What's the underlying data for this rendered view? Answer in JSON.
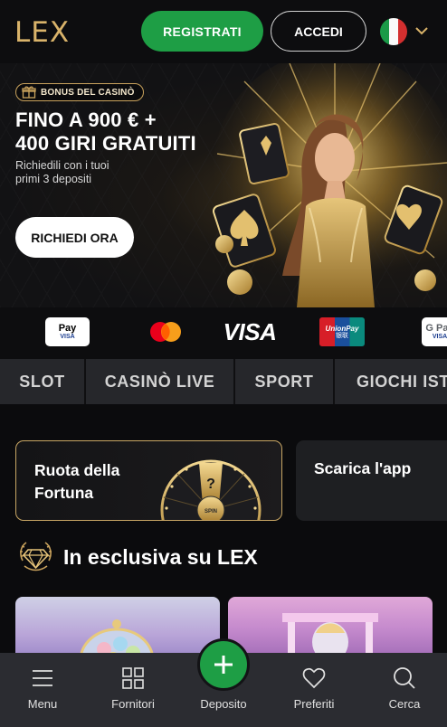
{
  "header": {
    "logo": "LEX",
    "register_label": "REGISTRATI",
    "login_label": "ACCEDI",
    "language_flag": "flag-italy-icon"
  },
  "hero": {
    "badge": "BONUS DEL CASINÒ",
    "title_line1": "FINO A 900 € +",
    "title_line2": "400 GIRI GRATUITI",
    "subtitle": "Richiedili con i tuoi primi 3 depositi",
    "cta_label": "RICHIEDI ORA"
  },
  "payments": {
    "applepay": {
      "line1": "Pay",
      "line2": "VISA"
    },
    "visa": "VISA",
    "unionpay": {
      "line1": "UnionPay",
      "line2": "银联"
    },
    "googlepay": {
      "line1": "G Pay",
      "line2": "VISA"
    }
  },
  "tabs": [
    {
      "label": "SLOT"
    },
    {
      "label": "CASINÒ LIVE"
    },
    {
      "label": "SPORT"
    },
    {
      "label": "GIOCHI IST"
    }
  ],
  "promos": {
    "wheel_title": "Ruota della Fortuna",
    "wheel_spin": "SPIN",
    "wheel_question": "?",
    "app_title": "Scarica l'app"
  },
  "exclusive": {
    "title": "In esclusiva su LEX"
  },
  "bottom_nav": {
    "menu": "Menu",
    "providers": "Fornitori",
    "deposit": "Deposito",
    "favorites": "Preferiti",
    "search": "Cerca"
  },
  "colors": {
    "brand_gold": "#d9b36a",
    "accent_green": "#1e9e45",
    "background": "#0b0b0d",
    "tab_bar": "#26272b",
    "bottom_nav": "#2b2c31"
  }
}
